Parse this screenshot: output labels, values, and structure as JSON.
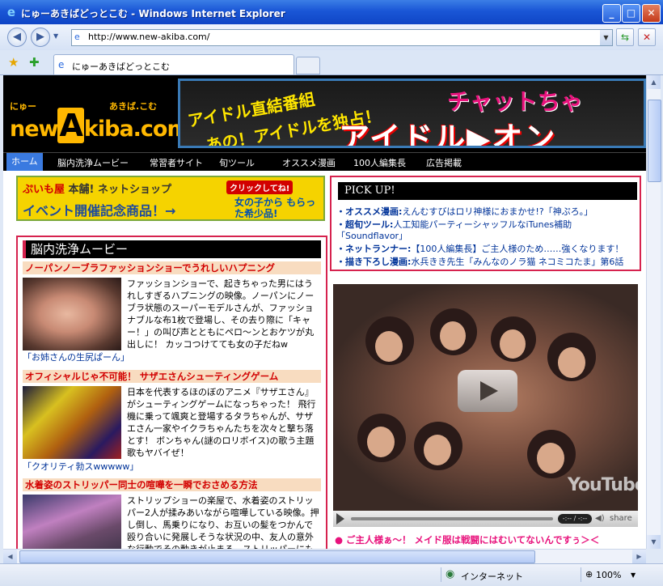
{
  "window": {
    "title": "にゅーあきばどっとこむ - Windows Internet Explorer",
    "minimize": "_",
    "maximize": "□",
    "close": "✕"
  },
  "address": {
    "url": "http://www.new-akiba.com/"
  },
  "tab": {
    "label": "にゅーあきばどっとこむ"
  },
  "status": {
    "zone": "インターネット",
    "zoom": "100%"
  },
  "site": {
    "logo_small_left": "にゅー",
    "logo_small_right": "あきば.こむ",
    "logo_pre": "new",
    "logo_a": "A",
    "logo_post": "kiba.com",
    "banner": {
      "line1": "アイドル直結番組",
      "line2": "あの！アイドルを独占！",
      "chat": "チャットちゃ",
      "main": "アイドル▶オン"
    },
    "nav": [
      "ホーム",
      "脳内洗浄ムービー",
      "常習者サイト",
      "旬ツール",
      "オススメ漫画",
      "100人編集長",
      "広告掲載"
    ],
    "shop": {
      "title_red": "ぷいも屋",
      "title_rest": " 本舗! ネットショップ",
      "click": "クリックしてね!",
      "line": "イベント開催記念商品！→",
      "side": "女の子から もらった希少品!"
    },
    "pickup": {
      "title": "PICK UP!",
      "items": [
        {
          "label": "・オススメ漫画:",
          "text": "えんむすびはロリ神様におまかせ!?「神ぷろ。」"
        },
        {
          "label": "・超旬ツール:",
          "text": "人工知能パーティーシャッフルなiTunes補助"
        },
        {
          "label": "",
          "text": "「Soundflavor」"
        },
        {
          "label": "・ネットランナー:",
          "text": "【100人編集長】ご主人様のため……強くなります！"
        },
        {
          "label": "・描き下ろし漫画:",
          "text": "水兵きき先生「みんなのノラ猫 ネコミコたま」第6話"
        }
      ]
    },
    "movie": {
      "header": "脳内洗浄ムービー",
      "entries": [
        {
          "title": "ノーパンノーブラファッションショーでうれしいハプニング",
          "text": "ファッションショーで、起きちゃった男にはうれしすぎるハプニングの映像。ノーパンにノーブラ状態のスーパーモデルさんが、ファッショナブルな布1枚で登場し、その去り際に「キャー！」の叫び声とともにペロ〜ンとおケツが丸出しに！ カッコつけてても女の子だねw",
          "foot": "「お姉さんの生尻ぱーん」"
        },
        {
          "title": "オフィシャルじゃ不可能！ サザエさんシューティングゲーム",
          "text": "日本を代表するほのぼのアニメ『サザエさん』がシューティングゲームになっちゃった！ 飛行機に乗って颯爽と登場するタラちゃんが、サザエさん一家やイクラちゃんたちを次々と撃ち落とす！ ボンちゃん(謎のロリボイス)の歌う主題歌もヤバイぜ！",
          "foot": "「クオリティ勃スwwwww」"
        },
        {
          "title": "水着姿のストリッパー同士の喧嘩を一瞬でおさめる方法",
          "text": "ストリップショーの楽屋で、水着姿のストリッパー2人が揉みあいながら喧嘩している映像。押し倒し、馬乗りになり、お互いの髪をつかんで殴り合いに発展しそうな状況の中、友人の意外な行動でその動きが止まる。ストリッパーにも恥じらい",
          "foot": ""
        }
      ]
    },
    "video": {
      "time": "-:-- / -:--",
      "share": "share",
      "logo": "YouTube",
      "caption": "● ご主人様ぁ〜！ メイド服は戦闘にはむいてないんですぅ＞＜"
    }
  }
}
